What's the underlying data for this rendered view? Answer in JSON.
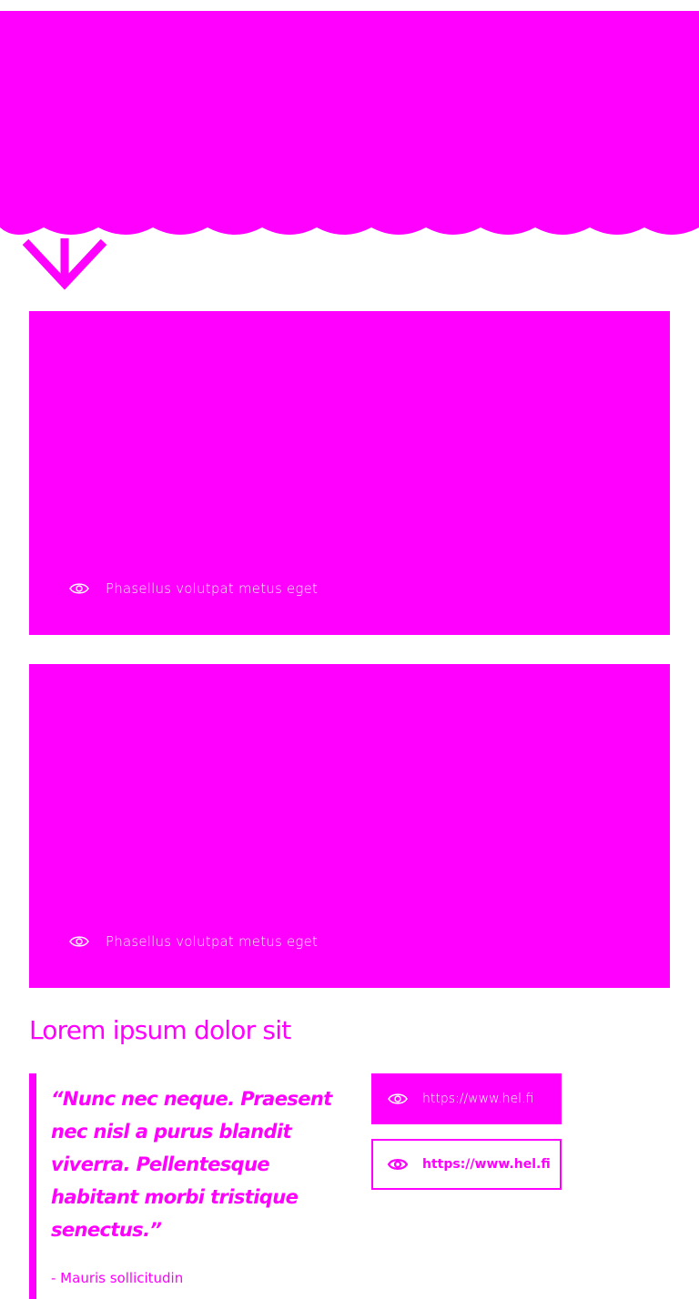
{
  "colors": {
    "accent": "#ff00ff",
    "background": "#ffffff",
    "on_accent": "#ffffff"
  },
  "hero": {
    "scroll_icon": "arrow-down-icon"
  },
  "cards": [
    {
      "icon": "eye-icon",
      "caption": "Phasellus volutpat metus eget"
    },
    {
      "icon": "eye-icon",
      "caption": "Phasellus volutpat metus eget"
    }
  ],
  "section": {
    "heading": "Lorem ipsum dolor sit"
  },
  "quote": {
    "text": "“Nunc nec neque. Praesent nec nisl a purus blandit viverra. Pellentesque habitant morbi tristique senectus.”",
    "author": "- Mauris sollicitudin"
  },
  "links": [
    {
      "icon": "eye-icon",
      "label": "https://www.hel.fi",
      "style": "filled"
    },
    {
      "icon": "eye-icon",
      "label": "https://www.hel.fi",
      "style": "outline"
    }
  ]
}
